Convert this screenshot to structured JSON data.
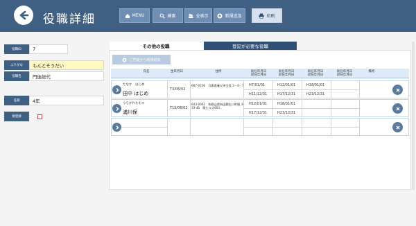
{
  "header": {
    "title": "役職詳細",
    "buttons": {
      "menu": "MENU",
      "search": "検索",
      "show_all": "全表示",
      "new": "新規追加",
      "print": "印刷"
    }
  },
  "form": {
    "id_label": "役職ID",
    "id_value": "7",
    "kana_label": "ふりがな",
    "kana_value": "もんとそうだい",
    "name_label": "役職名",
    "name_value": "門徒総代",
    "term_label": "任期",
    "term_value": "4年",
    "required_label": "要登録"
  },
  "tabs": {
    "other": "その他の役職",
    "required": "登記が必要な役職"
  },
  "list": {
    "add_button": "ご門徒から新規追加",
    "columns": {
      "name": "氏名",
      "birth": "生年月日",
      "address": "住所",
      "appt1": "就任年月日",
      "appt1b": "退任年月日",
      "appt2": "就任年月日",
      "appt2b": "退任年月日",
      "appt3": "就任年月日",
      "appt3b": "退任年月日",
      "appt4": "就任年月日",
      "appt4b": "退任年月日",
      "note": "備考"
    },
    "records": [
      {
        "kana": "たなか　はじめ",
        "name": "田中 はじめ",
        "birth": "T3/06/02",
        "address": "667-0106　兵庫県養父市玉見 3－4－7",
        "d1a": "H7/01/01",
        "d1b": "H11/12/31",
        "d2a": "H12/01/01",
        "d2b": "H17/12/31",
        "d3a": "H18/01/01",
        "d3b": "H23/12/31"
      },
      {
        "kana": "うらかわたもつ",
        "name": "浦川保",
        "birth": "T15/06/01",
        "address": "643-0062　和歌山県有田郡広川町殿 3-33-45　殿ヒルズ603",
        "d1a": "H12/01/01",
        "d1b": "H17/12/31",
        "d2a": "H18/01/01",
        "d2b": "H23/12/31",
        "d3a": "",
        "d3b": ""
      }
    ]
  },
  "colors": {
    "header": "#3f5f83",
    "accent": "#5b7a9e",
    "table_head": "#dcebf7"
  }
}
